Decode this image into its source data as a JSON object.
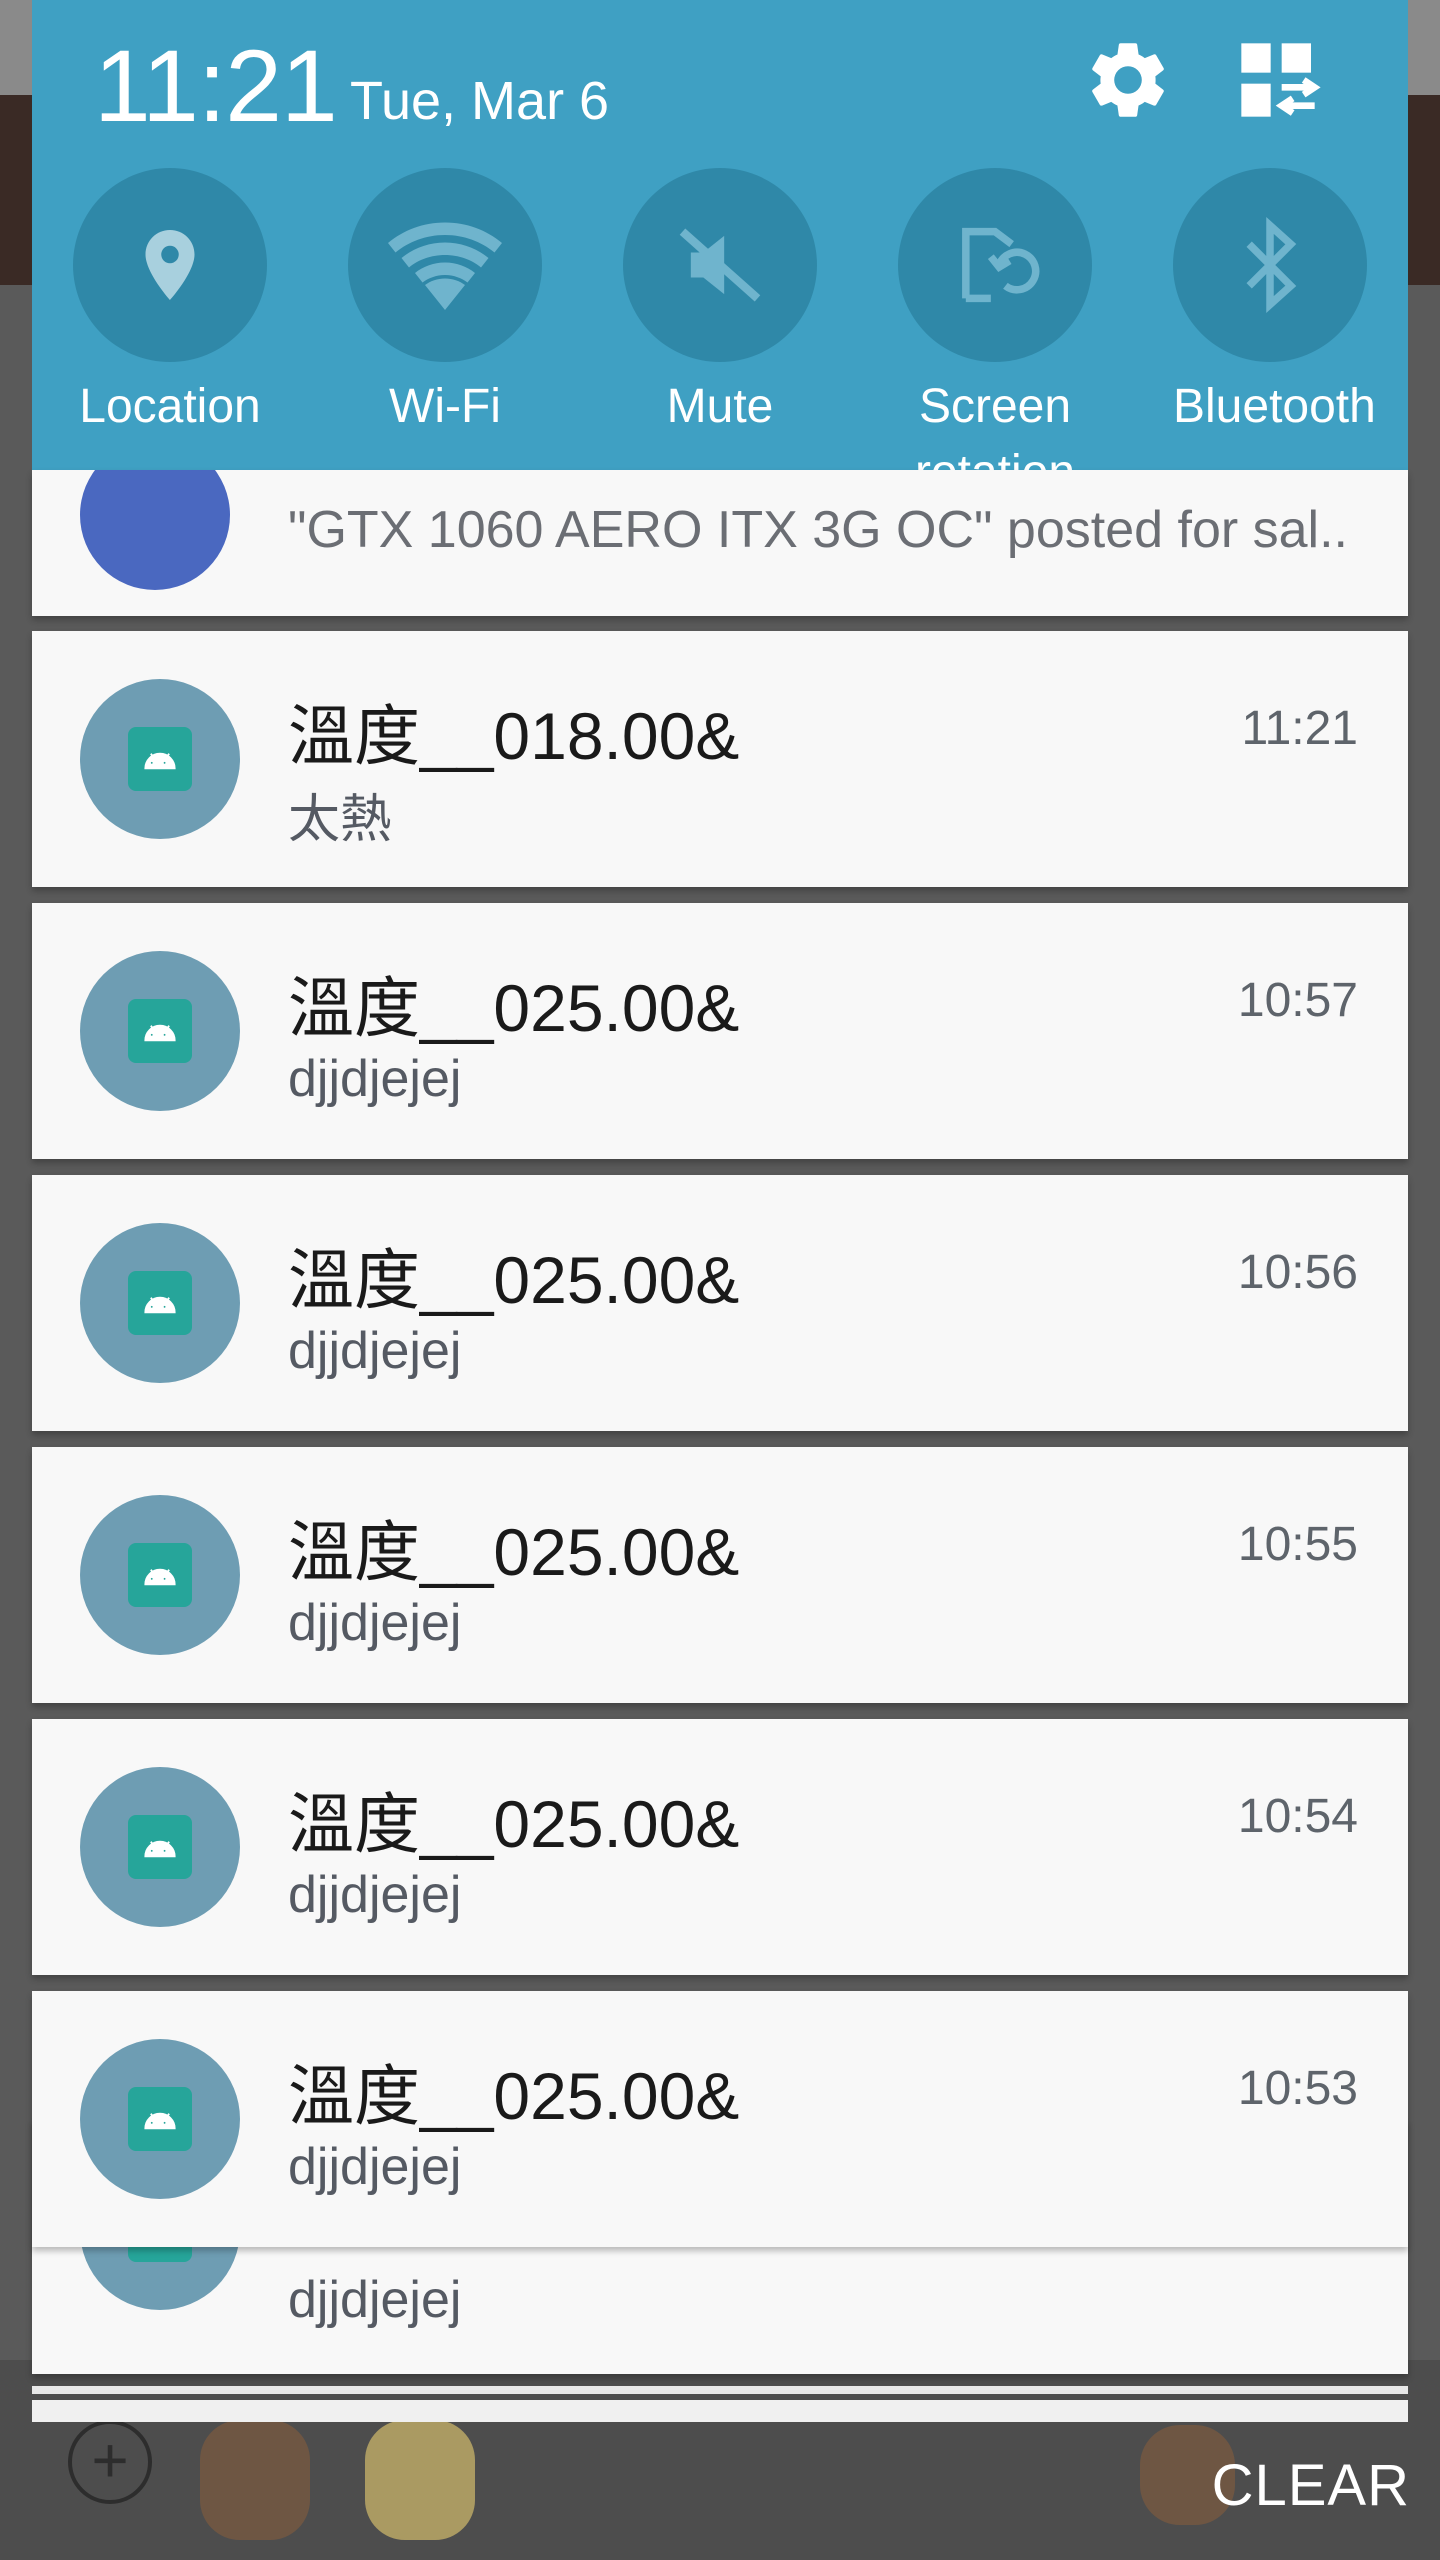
{
  "quick_settings": {
    "time": "11:21",
    "date": "Tue, Mar 6",
    "settings_icon": "gear-icon",
    "edit_icon": "tiles-edit-icon",
    "toggles": [
      {
        "label": "Location",
        "icon": "location-pin-icon"
      },
      {
        "label": "Wi-Fi",
        "icon": "wifi-icon"
      },
      {
        "label": "Mute",
        "icon": "mute-icon"
      },
      {
        "label_line1": "Screen",
        "label_line2": "rotation",
        "icon": "screen-rotation-icon"
      },
      {
        "label": "Bluetooth",
        "icon": "bluetooth-icon"
      }
    ]
  },
  "notifications": {
    "partial_top_text": "\"GTX 1060 AERO ITX 3G OC\" posted for sal..",
    "items": [
      {
        "title": "溫度__018.00&",
        "text": "太熱",
        "time": "11:21"
      },
      {
        "title": "溫度__025.00&",
        "text": "djjdjejej",
        "time": "10:57"
      },
      {
        "title": "溫度__025.00&",
        "text": "djjdjejej",
        "time": "10:56"
      },
      {
        "title": "溫度__025.00&",
        "text": "djjdjejej",
        "time": "10:55"
      },
      {
        "title": "溫度__025.00&",
        "text": "djjdjejej",
        "time": "10:54"
      },
      {
        "title": "溫度__025.00&",
        "text": "djjdjejej",
        "time": "10:53"
      }
    ],
    "stacked_text": "djjdjejej",
    "clear_label": "CLEAR"
  },
  "colors": {
    "qs_background": "#3fa0c3",
    "toggle_circle": "#2f88a8",
    "card_background": "#f8f8f8",
    "avatar": "#6e9db3",
    "app_icon": "#26a59a"
  }
}
